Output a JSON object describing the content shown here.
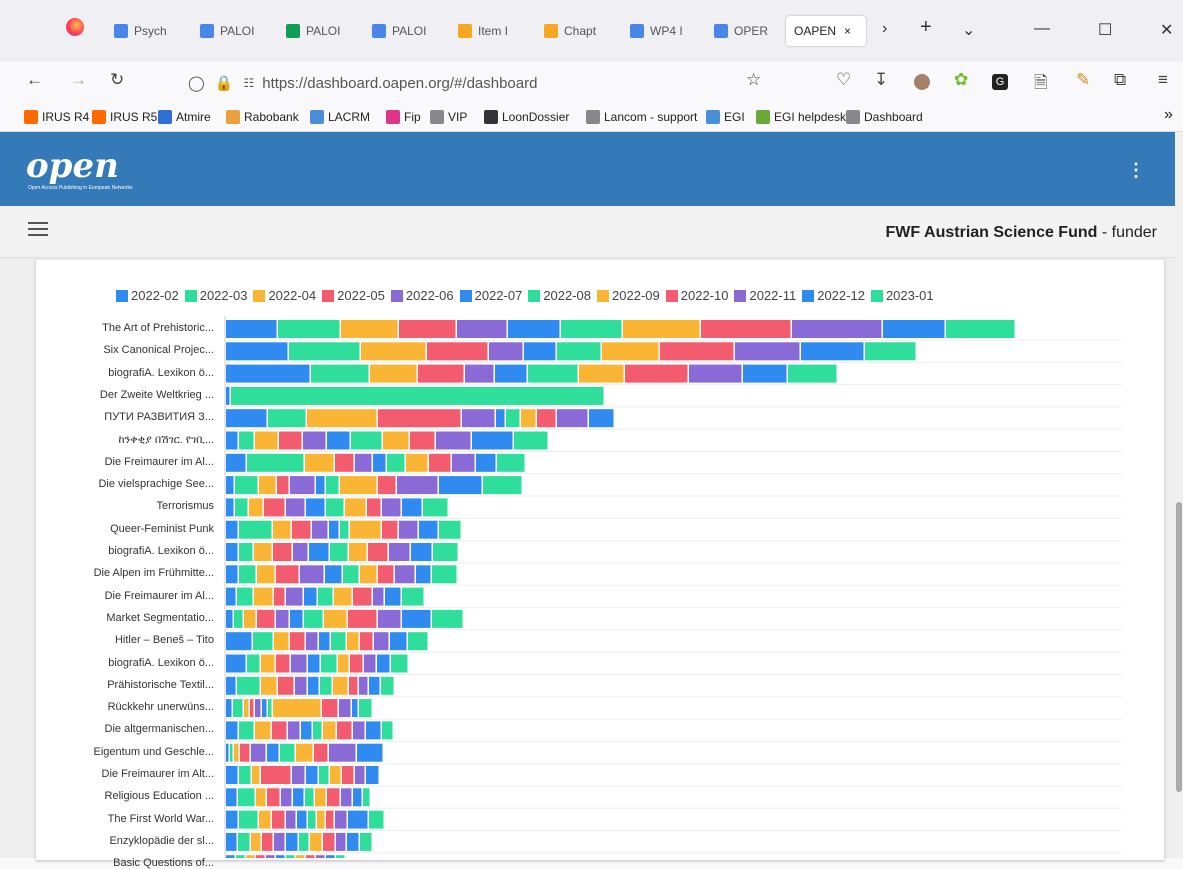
{
  "tabs": [
    {
      "label": "Psych",
      "icon": "document-icon",
      "color": "#4a86e8"
    },
    {
      "label": "PALOI",
      "icon": "docs-icon",
      "color": "#4a86e8"
    },
    {
      "label": "PALOI",
      "icon": "sheets-icon",
      "color": "#0f9d58"
    },
    {
      "label": "PALOI",
      "icon": "docs-icon",
      "color": "#4a86e8"
    },
    {
      "label": "Item I",
      "icon": "dspace-icon",
      "color": "#f5a623"
    },
    {
      "label": "Chapt",
      "icon": "dspace-icon",
      "color": "#f5a623"
    },
    {
      "label": "WP4 I",
      "icon": "docs-icon",
      "color": "#4a86e8"
    },
    {
      "label": "OPER",
      "icon": "docs-icon",
      "color": "#4a86e8"
    }
  ],
  "active_tab": {
    "label": "OAPEN"
  },
  "url": "https://dashboard.oapen.org/#/dashboard",
  "bookmarks": [
    {
      "label": "IRUS R4",
      "icon": "irus-icon"
    },
    {
      "label": "IRUS R5",
      "icon": "irus-icon"
    },
    {
      "label": "Atmire",
      "icon": "atmire-icon"
    },
    {
      "label": "Rabobank",
      "icon": "rabobank-icon"
    },
    {
      "label": "LACRM",
      "icon": "lacrm-icon"
    },
    {
      "label": "Fip",
      "icon": "fip-icon"
    },
    {
      "label": "VIP",
      "icon": "globe-icon"
    },
    {
      "label": "LoonDossier",
      "icon": "loondossier-icon"
    },
    {
      "label": "Lancom - support",
      "icon": "globe-icon"
    },
    {
      "label": "EGI",
      "icon": "egi-icon"
    },
    {
      "label": "EGI helpdesk",
      "icon": "egi-helpdesk-icon"
    },
    {
      "label": "Dashboard",
      "icon": "globe-icon"
    }
  ],
  "header": {
    "logo_text": "open",
    "logo_sub": "Open Access Publishing in European Networks"
  },
  "subheader": {
    "funder_name": "FWF Austrian Science Fund",
    "funder_suffix": " - funder"
  },
  "colors": {
    "blue": "#2f8bf0",
    "green": "#2ede9a",
    "yellow": "#fbb535",
    "red": "#f35b6f",
    "purple": "#8a6ad6"
  },
  "chart_data": {
    "type": "bar",
    "stacked": true,
    "orientation": "horizontal",
    "legend_position": "top",
    "series_names": [
      "2022-02",
      "2022-03",
      "2022-04",
      "2022-05",
      "2022-06",
      "2022-07",
      "2022-08",
      "2022-09",
      "2022-10",
      "2022-11",
      "2022-12",
      "2023-01"
    ],
    "series_colors": [
      "#2f8bf0",
      "#2ede9a",
      "#fbb535",
      "#f35b6f",
      "#8a6ad6",
      "#2f8bf0",
      "#2ede9a",
      "#fbb535",
      "#f35b6f",
      "#8a6ad6",
      "#2f8bf0",
      "#2ede9a"
    ],
    "categories": [
      "The Art of Prehistoric...",
      "Six Canonical Projec...",
      "biografiA. Lexikon ö...",
      "Der Zweite Weltkrieg ...",
      "ПУТИ РАЗВИТИЯ З...",
      "ከንቀቂያ በሽገር. የገቢ...",
      "Die Freimaurer im Al...",
      "Die vielsprachige See...",
      "Terrorismus",
      "Queer-Feminist Punk",
      "biografiA. Lexikon ö...",
      "Die Alpen im Frühmitte...",
      "Die Freimaurer im Al...",
      "Market Segmentatio...",
      "Hitler – Beneš – Tito",
      "biografiA. Lexikon ö...",
      "Prähistorische Textil...",
      "Rückkehr unerwüns...",
      "Die altgermanischen...",
      "Eigentum und Geschle...",
      "Die Freimaurer im Alt...",
      "Religious Education ...",
      "The First World War...",
      "Enzyklopädie der sl...",
      "Basic Questions of..."
    ],
    "values": [
      [
        52,
        63,
        58,
        58,
        51,
        53,
        62,
        78,
        91,
        91,
        63,
        70
      ],
      [
        63,
        72,
        66,
        62,
        35,
        33,
        45,
        58,
        75,
        66,
        64,
        52
      ],
      [
        85,
        59,
        48,
        47,
        30,
        33,
        51,
        46,
        64,
        54,
        45,
        50
      ],
      [
        5,
        374,
        0,
        0,
        0,
        0,
        0,
        0,
        0,
        0,
        0,
        0
      ],
      [
        42,
        39,
        71,
        84,
        34,
        10,
        15,
        16,
        20,
        32,
        26,
        0
      ],
      [
        13,
        16,
        24,
        24,
        24,
        24,
        32,
        27,
        26,
        36,
        42,
        35
      ],
      [
        21,
        58,
        30,
        20,
        18,
        14,
        19,
        23,
        23,
        24,
        21,
        29
      ],
      [
        9,
        24,
        18,
        13,
        26,
        10,
        14,
        38,
        19,
        42,
        44,
        40
      ],
      [
        9,
        14,
        15,
        22,
        20,
        20,
        19,
        22,
        15,
        20,
        21,
        26
      ],
      [
        13,
        34,
        19,
        20,
        17,
        11,
        10,
        32,
        17,
        20,
        20,
        23
      ],
      [
        13,
        15,
        19,
        20,
        16,
        21,
        19,
        19,
        21,
        22,
        22,
        26
      ],
      [
        13,
        18,
        19,
        24,
        25,
        18,
        17,
        18,
        17,
        21,
        16,
        26
      ],
      [
        11,
        17,
        20,
        12,
        18,
        14,
        16,
        19,
        20,
        12,
        17,
        23
      ],
      [
        8,
        10,
        13,
        19,
        14,
        14,
        20,
        24,
        30,
        24,
        30,
        32
      ],
      [
        27,
        21,
        16,
        16,
        13,
        12,
        16,
        13,
        14,
        16,
        18,
        21
      ],
      [
        21,
        14,
        15,
        15,
        17,
        13,
        17,
        12,
        14,
        13,
        14,
        18
      ],
      [
        11,
        24,
        17,
        17,
        13,
        12,
        13,
        16,
        10,
        10,
        12,
        14
      ],
      [
        7,
        11,
        6,
        5,
        7,
        6,
        5,
        49,
        17,
        13,
        7,
        14
      ],
      [
        13,
        16,
        17,
        16,
        13,
        12,
        10,
        14,
        16,
        13,
        16,
        12
      ],
      [
        4,
        4,
        6,
        11,
        16,
        13,
        16,
        18,
        15,
        28,
        27,
        0
      ],
      [
        13,
        13,
        9,
        31,
        14,
        13,
        11,
        12,
        13,
        11,
        14,
        0
      ],
      [
        12,
        18,
        11,
        14,
        12,
        12,
        10,
        12,
        14,
        12,
        10,
        8
      ],
      [
        13,
        20,
        13,
        14,
        11,
        11,
        9,
        9,
        9,
        13,
        21,
        16
      ],
      [
        12,
        13,
        11,
        12,
        12,
        13,
        11,
        13,
        13,
        11,
        13,
        13
      ],
      [
        10,
        10,
        10,
        10,
        10,
        10,
        10,
        10,
        10,
        10,
        10,
        10
      ]
    ]
  }
}
